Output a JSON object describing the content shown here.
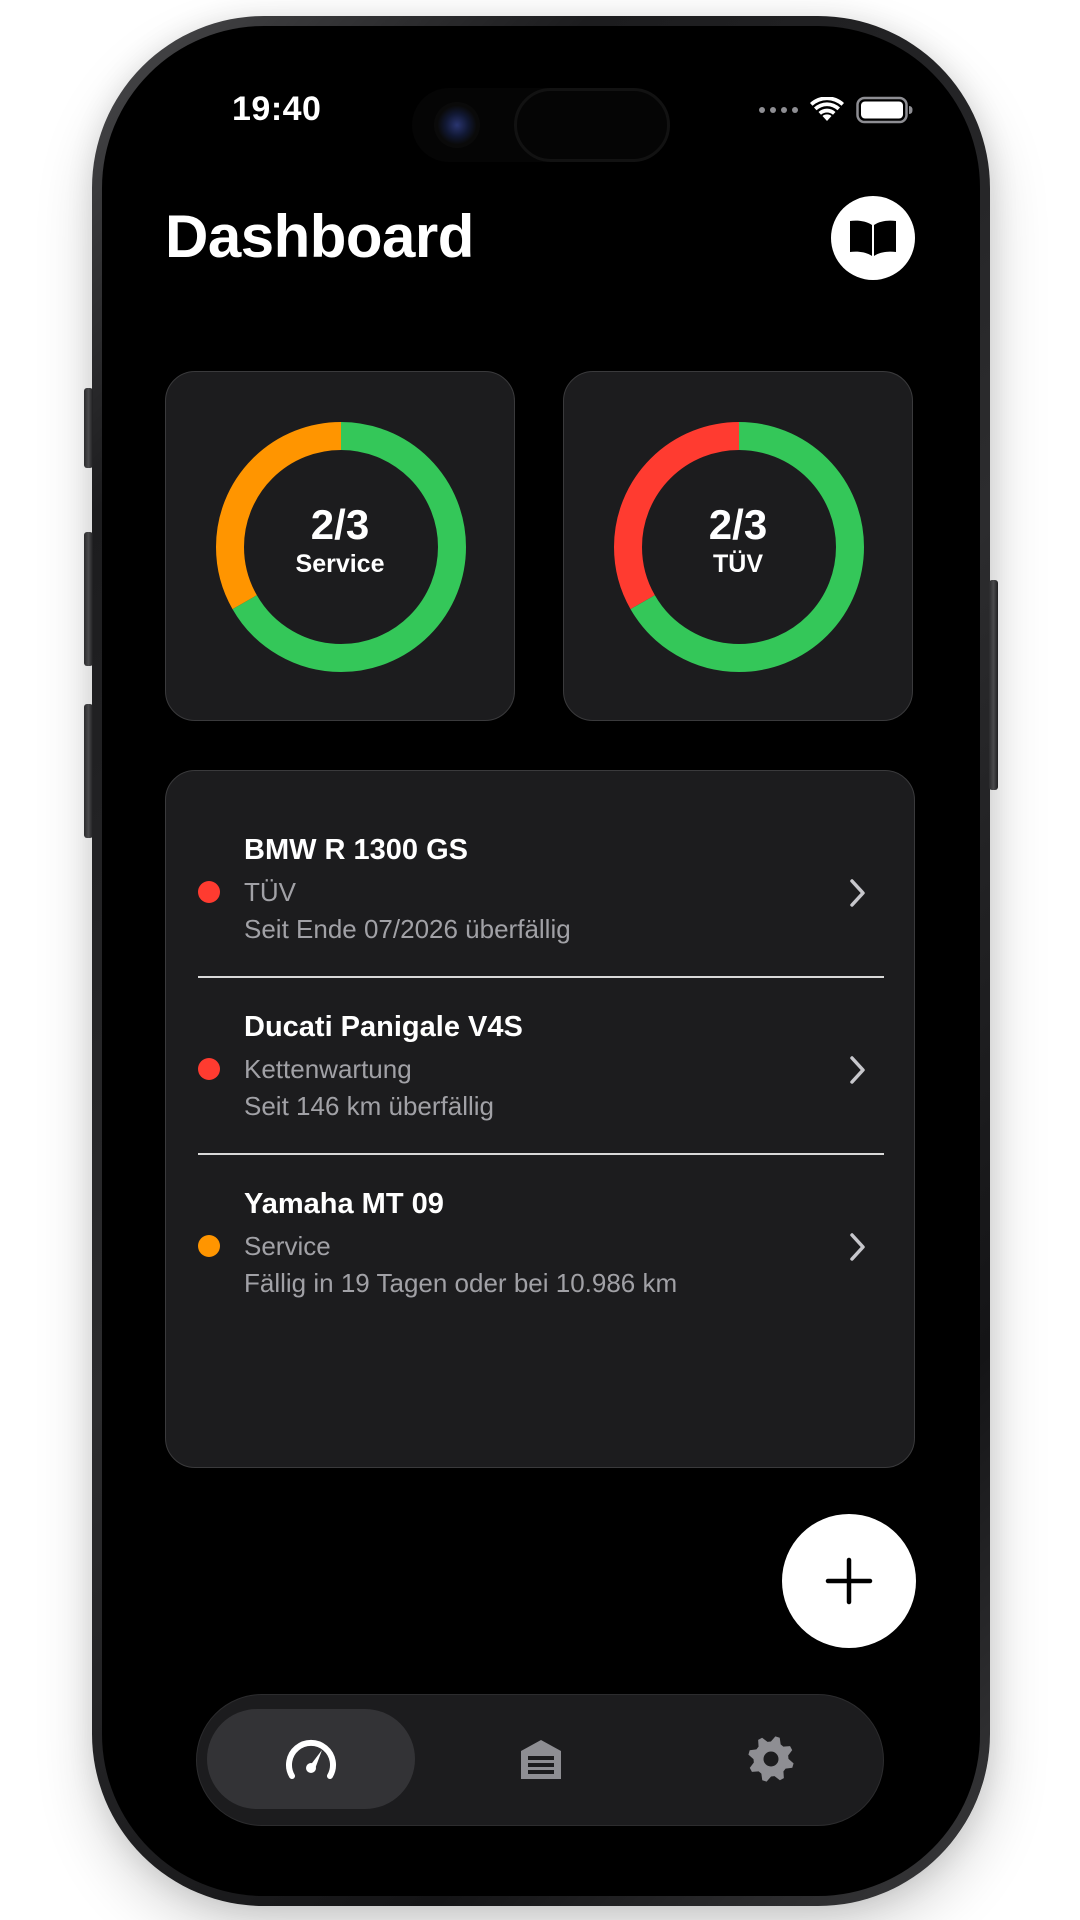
{
  "status_bar": {
    "time": "19:40"
  },
  "header": {
    "title": "Dashboard",
    "book_icon": "book-open-icon"
  },
  "rings": [
    {
      "value": "2/3",
      "label": "Service",
      "segments": [
        {
          "color": "#34c759",
          "fraction": 0.667
        },
        {
          "color": "#ff9500",
          "fraction": 0.333
        }
      ]
    },
    {
      "value": "2/3",
      "label": "TÜV",
      "segments": [
        {
          "color": "#34c759",
          "fraction": 0.667
        },
        {
          "color": "#ff3b30",
          "fraction": 0.333
        }
      ]
    }
  ],
  "vehicles": [
    {
      "name": "BMW R 1300 GS",
      "type": "TÜV",
      "detail": "Seit Ende 07/2026 überfällig",
      "status_color": "#ff3b30"
    },
    {
      "name": "Ducati Panigale V4S",
      "type": "Kettenwartung",
      "detail": "Seit 146 km überfällig",
      "status_color": "#ff3b30"
    },
    {
      "name": "Yamaha MT 09",
      "type": "Service",
      "detail": "Fällig in 19 Tagen oder bei 10.986 km",
      "status_color": "#ff9500"
    }
  ],
  "fab": {
    "icon": "plus-icon"
  },
  "tabbar": {
    "tabs": [
      {
        "icon": "speedometer-icon",
        "active": true
      },
      {
        "icon": "garage-icon",
        "active": false
      },
      {
        "icon": "gear-icon",
        "active": false
      }
    ]
  },
  "colors": {
    "background": "#000000",
    "card": "#1c1c1e",
    "green": "#34c759",
    "orange": "#ff9500",
    "red": "#ff3b30"
  }
}
